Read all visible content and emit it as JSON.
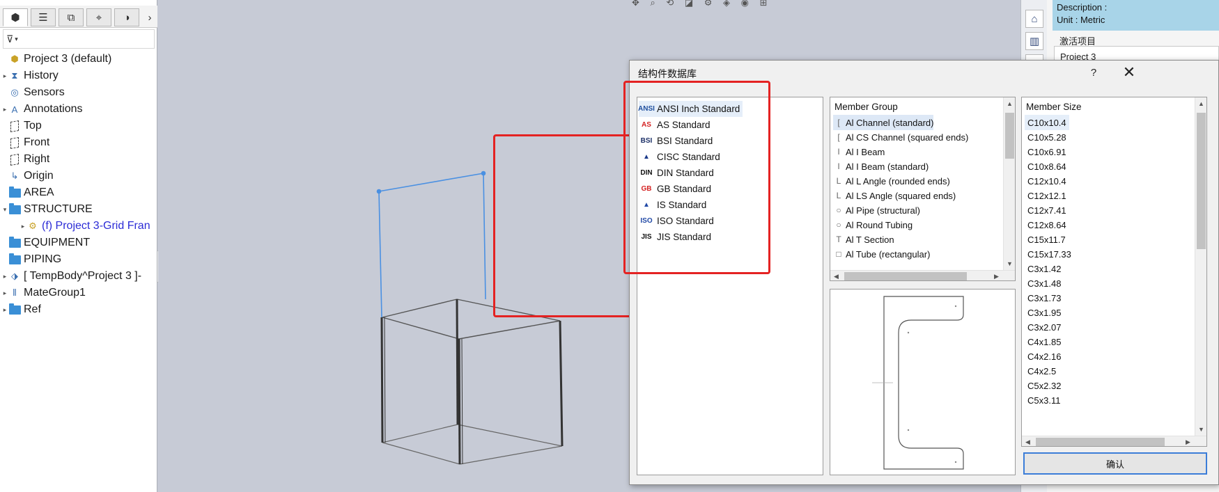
{
  "left_panel": {
    "tabs": [
      {
        "name": "feature-manager",
        "glyph": "⬢"
      },
      {
        "name": "property-manager",
        "glyph": "☰"
      },
      {
        "name": "configuration-manager",
        "glyph": "⧉"
      },
      {
        "name": "dimxpert-manager",
        "glyph": "⌖"
      },
      {
        "name": "display-manager",
        "glyph": "◑"
      }
    ],
    "more_tabs_glyph": "›",
    "filter_glyph": "⊽",
    "tree": [
      {
        "label": "Project 3  (default)",
        "arrow": "",
        "icon": "part-icon"
      },
      {
        "label": "History",
        "arrow": "▸",
        "icon": "history-icon"
      },
      {
        "label": "Sensors",
        "arrow": "",
        "icon": "sensor-icon"
      },
      {
        "label": "Annotations",
        "arrow": "▸",
        "icon": "annotation-icon"
      },
      {
        "label": "Top",
        "arrow": "",
        "icon": "plane-icon"
      },
      {
        "label": "Front",
        "arrow": "",
        "icon": "plane-icon"
      },
      {
        "label": "Right",
        "arrow": "",
        "icon": "plane-icon"
      },
      {
        "label": "Origin",
        "arrow": "",
        "icon": "origin-icon"
      },
      {
        "label": "AREA",
        "arrow": "",
        "icon": "folder-icon"
      },
      {
        "label": "STRUCTURE",
        "arrow": "▾",
        "icon": "folder-icon"
      },
      {
        "label": "(f) Project 3-Grid Fran",
        "arrow": "▸",
        "icon": "grid-frame-icon",
        "indent": 1,
        "color": "#2b2bd6"
      },
      {
        "label": "EQUIPMENT",
        "arrow": "",
        "icon": "folder-icon"
      },
      {
        "label": "PIPING",
        "arrow": "",
        "icon": "folder-icon"
      },
      {
        "label": "[ TempBody^Project 3 ]-",
        "arrow": "▸",
        "icon": "temp-body-icon"
      },
      {
        "label": "MateGroup1",
        "arrow": "▸",
        "icon": "mate-group-icon"
      },
      {
        "label": "Ref",
        "arrow": "▸",
        "icon": "folder-icon"
      }
    ]
  },
  "right_panel": {
    "description": "Description :",
    "unit": "Unit : Metric",
    "active_title": "激活项目",
    "active_value": "Project 3"
  },
  "dialog": {
    "title": "结构件数据库",
    "help": "?",
    "close": "✕",
    "standards": [
      {
        "label": "ANSI Inch Standard",
        "icon": "ansi-icon",
        "badge": "ANSI",
        "color": "#1f4f9e"
      },
      {
        "label": "AS Standard",
        "icon": "as-icon",
        "badge": "AS",
        "color": "#d42222"
      },
      {
        "label": "BSI Standard",
        "icon": "bsi-icon",
        "badge": "BSI",
        "color": "#1a2e66"
      },
      {
        "label": "CISC Standard",
        "icon": "cisc-icon",
        "badge": "▲",
        "color": "#1b3a8a"
      },
      {
        "label": "DIN Standard",
        "icon": "din-icon",
        "badge": "DIN",
        "color": "#111111"
      },
      {
        "label": "GB Standard",
        "icon": "gb-icon",
        "badge": "GB",
        "color": "#d42222"
      },
      {
        "label": "IS Standard",
        "icon": "is-icon",
        "badge": "▲",
        "color": "#2149a6"
      },
      {
        "label": "ISO Standard",
        "icon": "iso-icon",
        "badge": "ISO",
        "color": "#2149a6"
      },
      {
        "label": "JIS Standard",
        "icon": "jis-icon",
        "badge": "JIS",
        "color": "#111111"
      }
    ],
    "member_group_header": "Member Group",
    "member_groups": [
      {
        "label": "Al Channel (standard)",
        "icon": "["
      },
      {
        "label": "Al CS Channel (squared ends)",
        "icon": "["
      },
      {
        "label": "Al I Beam",
        "icon": "I"
      },
      {
        "label": "Al I Beam (standard)",
        "icon": "I"
      },
      {
        "label": "Al L Angle (rounded ends)",
        "icon": "L"
      },
      {
        "label": "Al LS Angle (squared ends)",
        "icon": "L"
      },
      {
        "label": "Al Pipe (structural)",
        "icon": "○"
      },
      {
        "label": "Al Round Tubing",
        "icon": "○"
      },
      {
        "label": "Al T Section",
        "icon": "T"
      },
      {
        "label": "Al Tube (rectangular)",
        "icon": "□"
      }
    ],
    "member_size_header": "Member Size",
    "member_sizes": [
      "C10x10.4",
      "C10x5.28",
      "C10x6.91",
      "C10x8.64",
      "C12x10.4",
      "C12x12.1",
      "C12x7.41",
      "C12x8.64",
      "C15x11.7",
      "C15x17.33",
      "C3x1.42",
      "C3x1.48",
      "C3x1.73",
      "C3x1.95",
      "C3x2.07",
      "C4x1.85",
      "C4x2.16",
      "C4x2.5",
      "C5x2.32",
      "C5x3.11"
    ],
    "confirm": "确认"
  },
  "colors": {
    "highlight": "#e42222",
    "sketch_line": "#4a90e2",
    "frame_line": "#333333",
    "selection": "#e5eef9"
  }
}
